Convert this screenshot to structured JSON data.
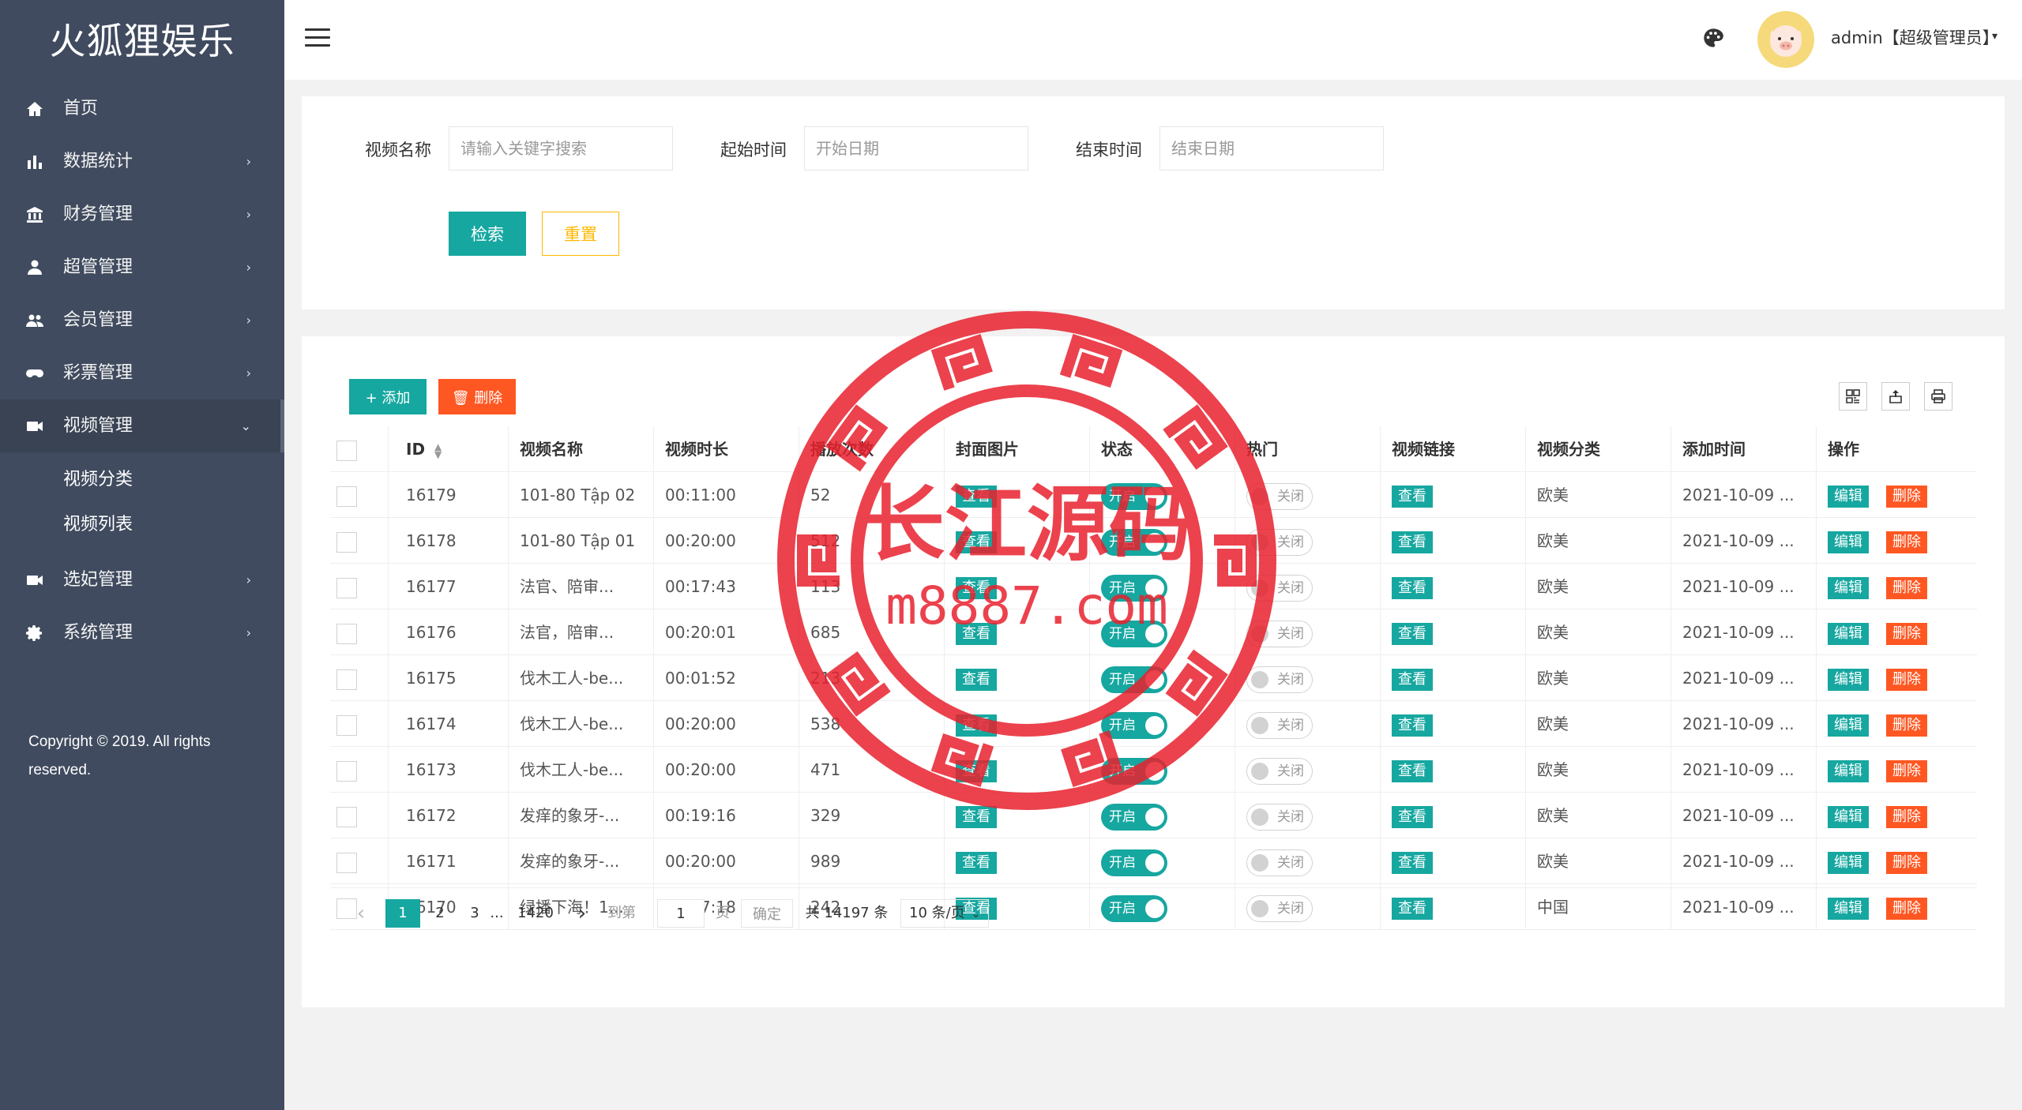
{
  "app": {
    "logo": "火狐狸娱乐"
  },
  "sidebar": {
    "items": [
      {
        "label": "首页",
        "icon": "home-icon",
        "arrow": ""
      },
      {
        "label": "数据统计",
        "icon": "bar-chart-icon",
        "arrow": "›"
      },
      {
        "label": "财务管理",
        "icon": "bank-icon",
        "arrow": "›"
      },
      {
        "label": "超管管理",
        "icon": "user-icon",
        "arrow": "›"
      },
      {
        "label": "会员管理",
        "icon": "group-icon",
        "arrow": "›"
      },
      {
        "label": "彩票管理",
        "icon": "gamepad-icon",
        "arrow": "›"
      },
      {
        "label": "视频管理",
        "icon": "video-icon",
        "arrow": "⌄"
      },
      {
        "label": "选妃管理",
        "icon": "video-icon",
        "arrow": "›"
      },
      {
        "label": "系统管理",
        "icon": "gear-icon",
        "arrow": "›"
      }
    ],
    "submenu": [
      "视频分类",
      "视频列表"
    ],
    "copyright": "Copyright © 2019. All rights reserved."
  },
  "header": {
    "user": "admin【超级管理员】",
    "caret": "▾"
  },
  "search": {
    "name_label": "视频名称",
    "name_placeholder": "请输入关键字搜索",
    "start_label": "起始时间",
    "start_placeholder": "开始日期",
    "end_label": "结束时间",
    "end_placeholder": "结束日期",
    "search_btn": "检索",
    "reset_btn": "重置"
  },
  "toolbar": {
    "add": "+ 添加",
    "delete": "🗑 删除"
  },
  "table": {
    "headers": [
      "ID",
      "视频名称",
      "视频时长",
      "播放次数",
      "封面图片",
      "状态",
      "热门",
      "视频链接",
      "视频分类",
      "添加时间",
      "操作"
    ],
    "view_label": "查看",
    "on_label": "开启",
    "off_label": "关闭",
    "edit_label": "编辑",
    "delete_label": "删除",
    "rows": [
      {
        "id": "16179",
        "name": "101-80 Tập 02",
        "duration": "00:11:00",
        "plays": "52",
        "category": "欧美",
        "time": "2021-10-09 ..."
      },
      {
        "id": "16178",
        "name": "101-80 Tập 01",
        "duration": "00:20:00",
        "plays": "512",
        "category": "欧美",
        "time": "2021-10-09 ..."
      },
      {
        "id": "16177",
        "name": "法官、陪审...",
        "duration": "00:17:43",
        "plays": "113",
        "category": "欧美",
        "time": "2021-10-09 ..."
      },
      {
        "id": "16176",
        "name": "法官，陪审...",
        "duration": "00:20:01",
        "plays": "685",
        "category": "欧美",
        "time": "2021-10-09 ..."
      },
      {
        "id": "16175",
        "name": "伐木工人-be...",
        "duration": "00:01:52",
        "plays": "213",
        "category": "欧美",
        "time": "2021-10-09 ..."
      },
      {
        "id": "16174",
        "name": "伐木工人-be...",
        "duration": "00:20:00",
        "plays": "538",
        "category": "欧美",
        "time": "2021-10-09 ..."
      },
      {
        "id": "16173",
        "name": "伐木工人-be...",
        "duration": "00:20:00",
        "plays": "471",
        "category": "欧美",
        "time": "2021-10-09 ..."
      },
      {
        "id": "16172",
        "name": "发痒的象牙-...",
        "duration": "00:19:16",
        "plays": "329",
        "category": "欧美",
        "time": "2021-10-09 ..."
      },
      {
        "id": "16171",
        "name": "发痒的象牙-...",
        "duration": "00:20:00",
        "plays": "989",
        "category": "欧美",
        "time": "2021-10-09 ..."
      },
      {
        "id": "16170",
        "name": "绿播下海！1...",
        "duration": "00:07:18",
        "plays": "242",
        "category": "中国",
        "time": "2021-10-09 ..."
      }
    ]
  },
  "pagination": {
    "prev": "‹",
    "pages": [
      "1",
      "2",
      "3",
      "...",
      "1420"
    ],
    "next": "›",
    "goto_label": "到第",
    "goto_value": "1",
    "page_unit": "页",
    "confirm": "确定",
    "total": "共 14197 条",
    "per_page": "10 条/页"
  },
  "watermark": {
    "title": "长江源码",
    "url": "m8887.com"
  },
  "colors": {
    "sidebar": "#404b5f",
    "primary": "#16a7a0",
    "danger": "#ff5722",
    "warning": "#ffb800",
    "watermark": "#e8222e"
  }
}
